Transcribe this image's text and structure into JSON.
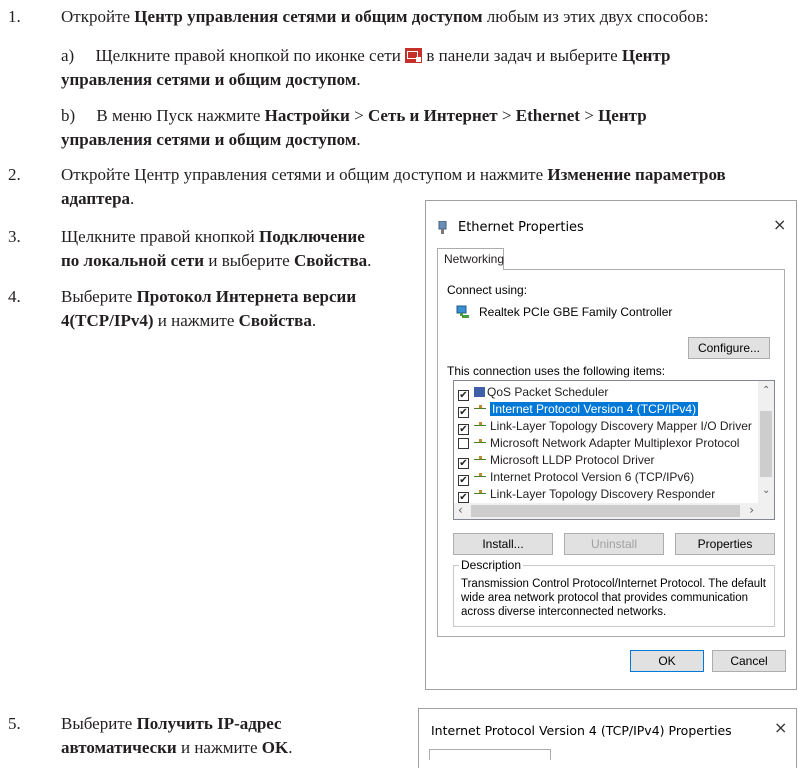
{
  "steps": {
    "s1": {
      "num": "1.",
      "text_a": "Откройте ",
      "bold_a": "Центр управления сетями и общим доступом",
      "text_b": " любым из этих двух способов:"
    },
    "s1a": {
      "label": "a)",
      "text_a": "Щелкните правой кнопкой по иконке сети ",
      "text_b": " в панели задач и выберите ",
      "bold_a": "Центр",
      "bold_b": "управления сетями и общим доступом",
      "text_c": "."
    },
    "s1b": {
      "label": "b)",
      "text_a": "В меню Пуск нажмите ",
      "bold_a": "Настройки",
      "sep": " > ",
      "bold_b": "Сеть и Интернет",
      "bold_c": "Ethernet",
      "bold_d": "Центр",
      "bold_e": "управления сетями и общим доступом",
      "text_c": "."
    },
    "s2": {
      "num": "2.",
      "text_a": "Откройте Центр управления сетями и общим доступом и нажмите ",
      "bold_a": "Изменение параметров",
      "bold_b": "адаптера",
      "text_b": "."
    },
    "s3": {
      "num": "3.",
      "text_a": "Щелкните правой кнопкой ",
      "bold_a": "Подключение",
      "bold_b": "по локальной сети",
      "text_b": " и выберите ",
      "bold_c": "Свойства",
      "text_c": "."
    },
    "s4": {
      "num": "4.",
      "text_a": "Выберите ",
      "bold_a": "Протокол Интернета версии",
      "bold_b": "4(TCP/IPv4)",
      "text_b": " и нажмите ",
      "bold_c": "Свойства",
      "text_c": "."
    },
    "s5": {
      "num": "5.",
      "text_a": "Выберите ",
      "bold_a": "Получить IP-адрес",
      "bold_b": "автоматически",
      "text_b": " и нажмите ",
      "bold_c": "OK",
      "text_c": "."
    }
  },
  "dialog1": {
    "title": "Ethernet Properties",
    "close": "×",
    "tab": "Networking",
    "connect_using": "Connect using:",
    "adapter": "Realtek PCIe GBE Family Controller",
    "configure": "Configure...",
    "items_label": "This connection uses the following items:",
    "items": [
      {
        "label": "QoS Packet Scheduler",
        "checked": "✔"
      },
      {
        "label": "Internet Protocol Version 4 (TCP/IPv4)",
        "checked": "✔"
      },
      {
        "label": "Link-Layer Topology Discovery Mapper I/O Driver",
        "checked": "✔"
      },
      {
        "label": "Microsoft Network Adapter Multiplexor Protocol",
        "checked": ""
      },
      {
        "label": "Microsoft LLDP Protocol Driver",
        "checked": "✔"
      },
      {
        "label": "Internet Protocol Version 6 (TCP/IPv6)",
        "checked": "✔"
      },
      {
        "label": "Link-Layer Topology Discovery Responder",
        "checked": "✔"
      }
    ],
    "install": "Install...",
    "uninstall": "Uninstall",
    "properties": "Properties",
    "description_label": "Description",
    "description": "Transmission Control Protocol/Internet Protocol. The default wide area network protocol that provides communication across diverse interconnected networks.",
    "ok": "OK",
    "cancel": "Cancel"
  },
  "dialog2": {
    "title": "Internet Protocol Version 4 (TCP/IPv4) Properties",
    "close": "×"
  }
}
